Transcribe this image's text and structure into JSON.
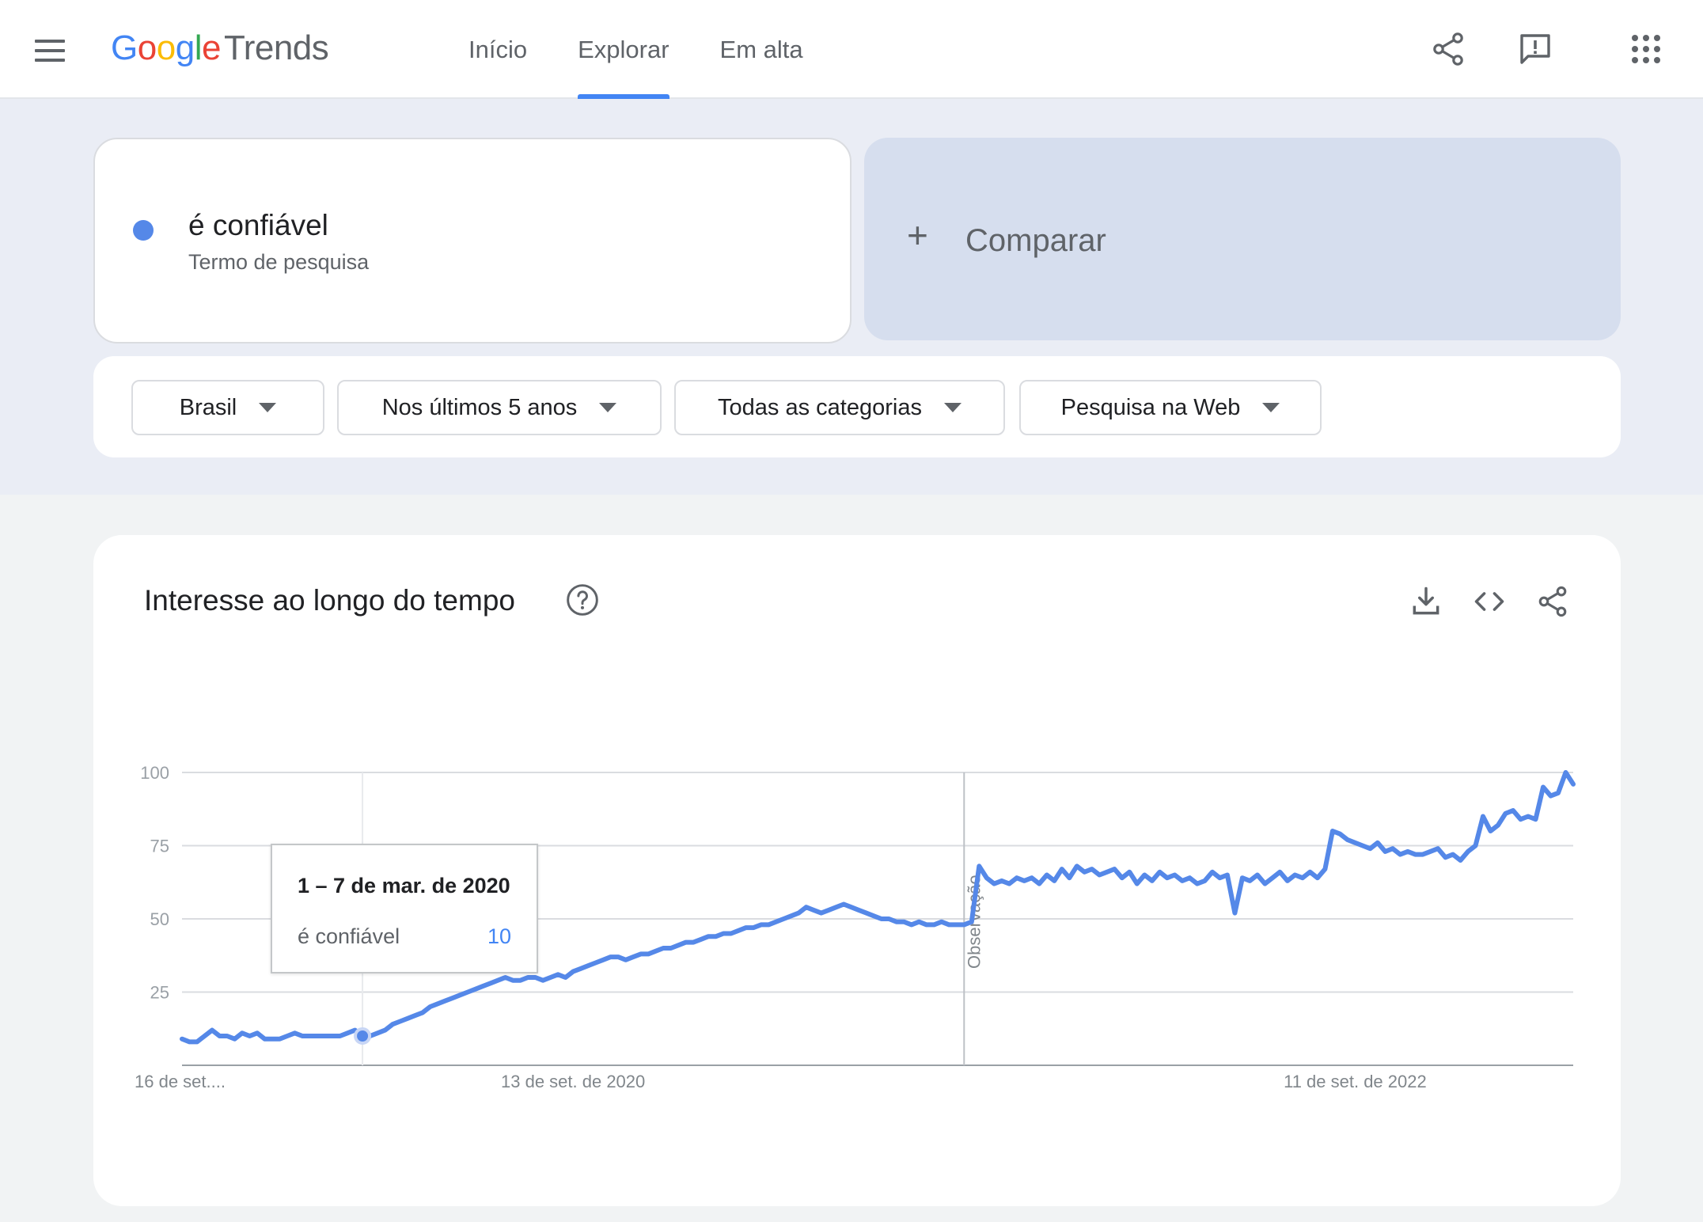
{
  "header": {
    "logo_google": "Google",
    "logo_product": "Trends",
    "nav": [
      {
        "label": "Início",
        "active": false
      },
      {
        "label": "Explorar",
        "active": true
      },
      {
        "label": "Em alta",
        "active": false
      }
    ],
    "icons": [
      "menu-icon",
      "share-icon",
      "feedback-icon",
      "apps-icon"
    ]
  },
  "term": {
    "name": "é confiável",
    "type": "Termo de pesquisa",
    "color": "#5588e8"
  },
  "compare": {
    "label": "Comparar",
    "icon": "plus-icon"
  },
  "filters": [
    {
      "label": "Brasil"
    },
    {
      "label": "Nos últimos 5 anos"
    },
    {
      "label": "Todas as categorias"
    },
    {
      "label": "Pesquisa na Web"
    }
  ],
  "chart_section": {
    "title": "Interesse ao longo do tempo",
    "icons": [
      "help-icon",
      "download-icon",
      "embed-icon",
      "share-icon"
    ]
  },
  "tooltip": {
    "date": "1 – 7 de mar. de 2020",
    "series_name": "é confiável",
    "value": "10"
  },
  "chart_data": {
    "type": "line",
    "title": "",
    "xlabel": "",
    "ylabel": "",
    "ylim": [
      0,
      100
    ],
    "yticks": [
      25,
      50,
      75,
      100
    ],
    "xtick_labels": [
      {
        "label": "16 de set....",
        "index": 0
      },
      {
        "label": "13 de set. de 2020",
        "index": 52
      },
      {
        "label": "11 de set. de 2022",
        "index": 156
      }
    ],
    "annotation": {
      "label": "Observação",
      "index": 104
    },
    "highlight_index": 24,
    "grid": true,
    "series": [
      {
        "name": "é confiável",
        "color": "#5588e8",
        "values": [
          9,
          8,
          8,
          10,
          12,
          10,
          10,
          9,
          11,
          10,
          11,
          9,
          9,
          9,
          10,
          11,
          10,
          10,
          10,
          10,
          10,
          10,
          11,
          12,
          10,
          10,
          11,
          12,
          14,
          15,
          16,
          17,
          18,
          20,
          21,
          22,
          23,
          24,
          25,
          26,
          27,
          28,
          29,
          30,
          29,
          29,
          30,
          30,
          29,
          30,
          31,
          30,
          32,
          33,
          34,
          35,
          36,
          37,
          37,
          36,
          37,
          38,
          38,
          39,
          40,
          40,
          41,
          42,
          42,
          43,
          44,
          44,
          45,
          45,
          46,
          47,
          47,
          48,
          48,
          49,
          50,
          51,
          52,
          54,
          53,
          52,
          53,
          54,
          55,
          54,
          53,
          52,
          51,
          50,
          50,
          49,
          49,
          48,
          49,
          48,
          48,
          49,
          48,
          48,
          48,
          49,
          68,
          64,
          62,
          63,
          62,
          64,
          63,
          64,
          62,
          65,
          63,
          67,
          64,
          68,
          66,
          67,
          65,
          66,
          67,
          64,
          66,
          62,
          65,
          63,
          66,
          64,
          65,
          63,
          64,
          62,
          63,
          66,
          64,
          65,
          52,
          64,
          63,
          65,
          62,
          64,
          66,
          63,
          65,
          64,
          66,
          64,
          67,
          80,
          79,
          77,
          76,
          75,
          74,
          76,
          73,
          74,
          72,
          73,
          72,
          72,
          73,
          74,
          71,
          72,
          70,
          73,
          75,
          85,
          80,
          82,
          86,
          87,
          84,
          85,
          84,
          95,
          92,
          93,
          100,
          96
        ]
      }
    ]
  }
}
